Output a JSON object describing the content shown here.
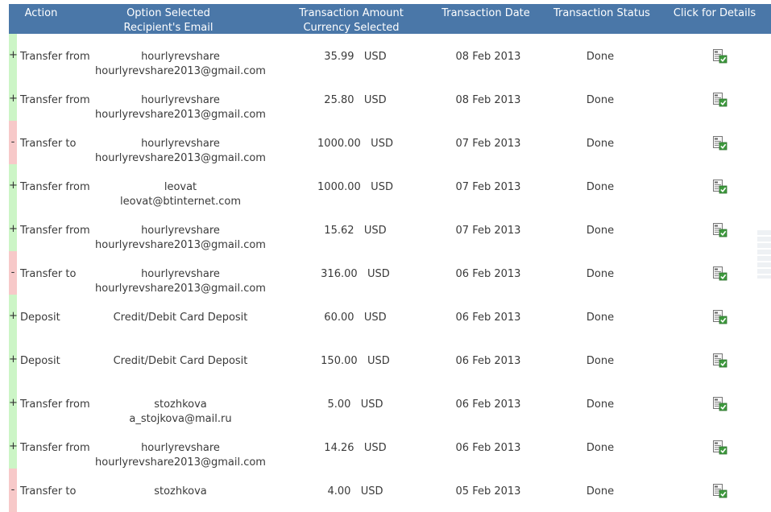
{
  "header": {
    "action": "Action",
    "option_line1": "Option Selected",
    "option_line2": "Recipient's Email",
    "amount_line1": "Transaction Amount",
    "amount_line2": "Currency Selected",
    "date": "Transaction Date",
    "status": "Transaction Status",
    "details": "Click for Details"
  },
  "colors": {
    "header_bg": "#4a77a8",
    "incoming": "#ccf5c6",
    "outgoing": "#f7c9c9"
  },
  "rows": [
    {
      "sign": "+",
      "action": "Transfer from",
      "option": "hourlyrevshare",
      "email": "hourlyrevshare2013@gmail.com",
      "amount": "35.99   USD",
      "date": "08 Feb 2013",
      "status": "Done",
      "type": "plus"
    },
    {
      "sign": "+",
      "action": "Transfer from",
      "option": "hourlyrevshare",
      "email": "hourlyrevshare2013@gmail.com",
      "amount": "25.80   USD",
      "date": "08 Feb 2013",
      "status": "Done",
      "type": "plus"
    },
    {
      "sign": "-",
      "action": "Transfer to",
      "option": "hourlyrevshare",
      "email": "hourlyrevshare2013@gmail.com",
      "amount": "1000.00   USD",
      "date": "07 Feb 2013",
      "status": "Done",
      "type": "minus"
    },
    {
      "sign": "+",
      "action": "Transfer from",
      "option": "leovat",
      "email": "leovat@btinternet.com",
      "amount": "1000.00   USD",
      "date": "07 Feb 2013",
      "status": "Done",
      "type": "plus"
    },
    {
      "sign": "+",
      "action": "Transfer from",
      "option": "hourlyrevshare",
      "email": "hourlyrevshare2013@gmail.com",
      "amount": "15.62   USD",
      "date": "07 Feb 2013",
      "status": "Done",
      "type": "plus"
    },
    {
      "sign": "-",
      "action": "Transfer to",
      "option": "hourlyrevshare",
      "email": "hourlyrevshare2013@gmail.com",
      "amount": "316.00   USD",
      "date": "06 Feb 2013",
      "status": "Done",
      "type": "minus"
    },
    {
      "sign": "+",
      "action": "Deposit",
      "option": "Credit/Debit Card Deposit",
      "email": "",
      "amount": "60.00   USD",
      "date": "06 Feb 2013",
      "status": "Done",
      "type": "plus"
    },
    {
      "sign": "+",
      "action": "Deposit",
      "option": "Credit/Debit Card Deposit",
      "email": "",
      "amount": "150.00   USD",
      "date": "06 Feb 2013",
      "status": "Done",
      "type": "plus"
    },
    {
      "sign": "+",
      "action": "Transfer from",
      "option": "stozhkova",
      "email": "a_stojkova@mail.ru",
      "amount": "5.00   USD",
      "date": "06 Feb 2013",
      "status": "Done",
      "type": "plus"
    },
    {
      "sign": "+",
      "action": "Transfer from",
      "option": "hourlyrevshare",
      "email": "hourlyrevshare2013@gmail.com",
      "amount": "14.26   USD",
      "date": "06 Feb 2013",
      "status": "Done",
      "type": "plus"
    },
    {
      "sign": "-",
      "action": "Transfer to",
      "option": "stozhkova",
      "email": "",
      "amount": "4.00   USD",
      "date": "05 Feb 2013",
      "status": "Done",
      "type": "minus"
    }
  ]
}
